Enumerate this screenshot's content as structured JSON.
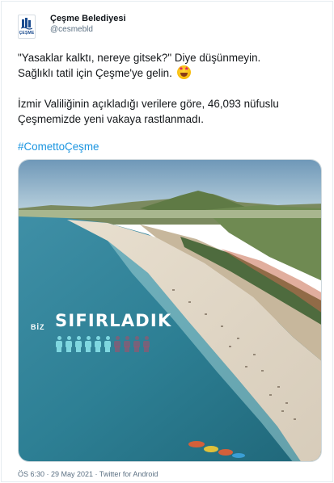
{
  "tweet": {
    "author_name": "Çeşme Belediyesi",
    "author_handle": "@cesmebld",
    "avatar_logo_text": "ÇEŞME",
    "line1": "\"Yasaklar kalktı, nereye gitsek?\" Diye düşünmeyin.",
    "line2": "Sağlıklı tatil için Çeşme'ye gelin.",
    "line3": "İzmir Valiliğinin açıkladığı verilere göre, 46,093 nüfuslu",
    "line4": "Çeşmemizde yeni vakaya rastlanmadı.",
    "hashtag": "#ComettoÇeşme",
    "emoji_icon": "star-struck-emoji-icon",
    "footer": "ÖS 6:30 · 29 May 2021 · Twitter for Android"
  },
  "media": {
    "overlay_small": "BİZ",
    "overlay_title": "SIFIRLADIK",
    "people_total": 10,
    "people_highlighted": 6,
    "highlight_color": "#7fd7e0",
    "dim_color": "#b04a66"
  },
  "colors": {
    "link": "#1b95e0",
    "secondary_text": "#5b7083"
  }
}
